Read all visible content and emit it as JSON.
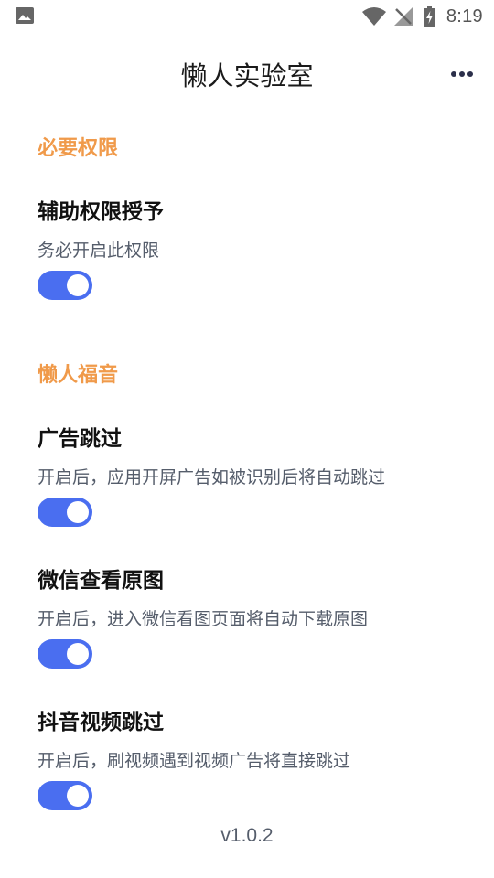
{
  "status_bar": {
    "time": "8:19",
    "icons": [
      "image-icon",
      "wifi-icon",
      "no-signal-icon",
      "battery-charging-icon"
    ]
  },
  "app_bar": {
    "title": "懒人实验室",
    "more_icon": "more-horizontal-icon"
  },
  "sections": [
    {
      "header": "必要权限",
      "items": [
        {
          "title": "辅助权限授予",
          "desc": "务必开启此权限",
          "enabled": true
        }
      ]
    },
    {
      "header": "懒人福音",
      "items": [
        {
          "title": "广告跳过",
          "desc": "开启后，应用开屏广告如被识别后将自动跳过",
          "enabled": true
        },
        {
          "title": "微信查看原图",
          "desc": "开启后，进入微信看图页面将自动下载原图",
          "enabled": true
        },
        {
          "title": "抖音视频跳过",
          "desc": "开启后，刷视频遇到视频广告将直接跳过",
          "enabled": true
        }
      ]
    }
  ],
  "version": "v1.0.2",
  "colors": {
    "accent": "#4a6ef0",
    "section_header": "#f09a4a"
  }
}
